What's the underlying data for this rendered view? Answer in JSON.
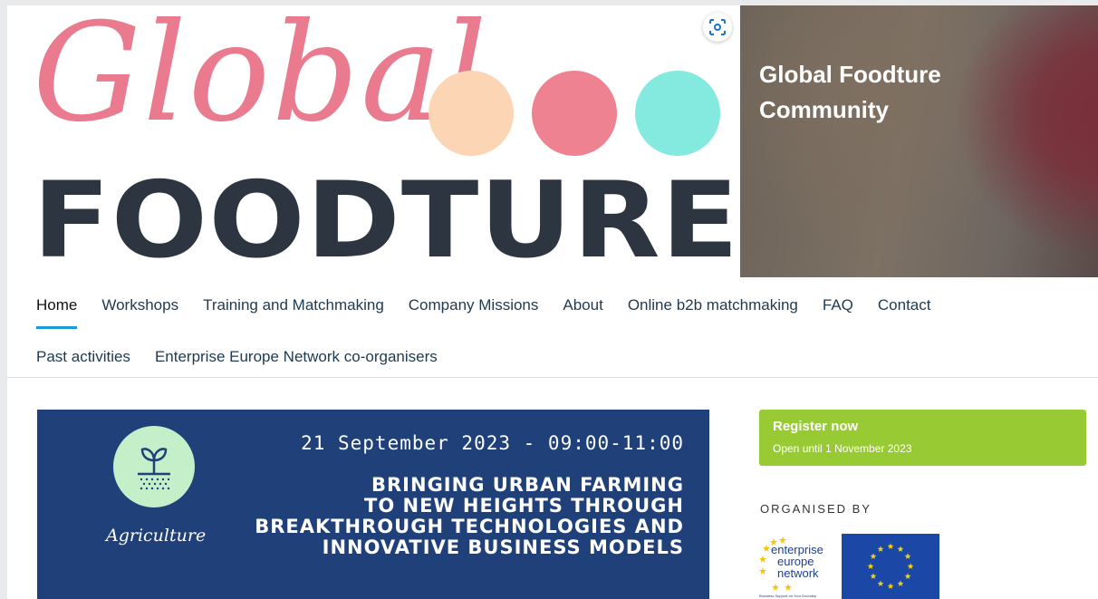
{
  "logo": {
    "script_word": "Global",
    "main_word": "FOODTURE",
    "dot_colors": [
      "#fcd5b5",
      "#ee8291",
      "#84eadf"
    ]
  },
  "hero": {
    "community_title_line1": "Global Foodture",
    "community_title_line2": "Community"
  },
  "nav": {
    "row1": [
      "Home",
      "Workshops",
      "Training and Matchmaking",
      "Company Missions",
      "About",
      "Online b2b matchmaking",
      "FAQ",
      "Contact"
    ],
    "row2": [
      "Past activities",
      "Enterprise Europe Network co-organisers"
    ],
    "active": "Home"
  },
  "event": {
    "category": "Agriculture",
    "date": "21 September 2023 - 09:00-11:00",
    "title_lines": [
      "BRINGING URBAN FARMING",
      "TO NEW HEIGHTS THROUGH",
      "BREAKTHROUGH TECHNOLOGIES AND",
      "INNOVATIVE BUSINESS MODELS"
    ]
  },
  "register": {
    "label": "Register now",
    "sublabel": "Open until 1 November 2023"
  },
  "organised_by": {
    "heading": "ORGANISED BY",
    "een_logo_text": [
      "enterprise",
      "europe",
      "network"
    ],
    "een_tagline": "Business Support on Your Doorstep"
  },
  "colors": {
    "accent_blue": "#1a9ad6",
    "register_green": "#98cb33",
    "banner_blue": "#1f4079"
  }
}
